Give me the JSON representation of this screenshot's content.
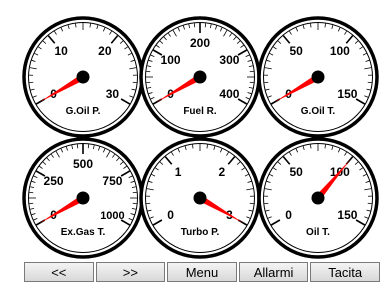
{
  "gauges": [
    {
      "label": "G.Oil P.",
      "ticks": [
        "0",
        "10",
        "20",
        "30"
      ],
      "value": 0
    },
    {
      "label": "Fuel R.",
      "ticks": [
        "0",
        "100",
        "200",
        "300",
        "400"
      ],
      "value": 0
    },
    {
      "label": "G.Oil T.",
      "ticks": [
        "0",
        "50",
        "100",
        "150"
      ],
      "value": 0
    },
    {
      "label": "Ex.Gas T.",
      "ticks": [
        "0",
        "250",
        "500",
        "750",
        "1000"
      ],
      "value": 0
    },
    {
      "label": "Turbo P.",
      "ticks": [
        "0",
        "1",
        "2",
        "3"
      ],
      "value": 3
    },
    {
      "label": "Oil T.",
      "ticks": [
        "0",
        "50",
        "100",
        "150"
      ],
      "value": 100
    }
  ],
  "buttons": [
    {
      "name": "prev-button",
      "label": "<<"
    },
    {
      "name": "next-button",
      "label": ">>"
    },
    {
      "name": "menu-button",
      "label": "Menu"
    },
    {
      "name": "allarmi-button",
      "label": "Allarmi"
    },
    {
      "name": "tacita-button",
      "label": "Tacita"
    }
  ],
  "colors": {
    "needle": "#ff0000",
    "bezel": "#000000",
    "face": "#ffffff"
  }
}
